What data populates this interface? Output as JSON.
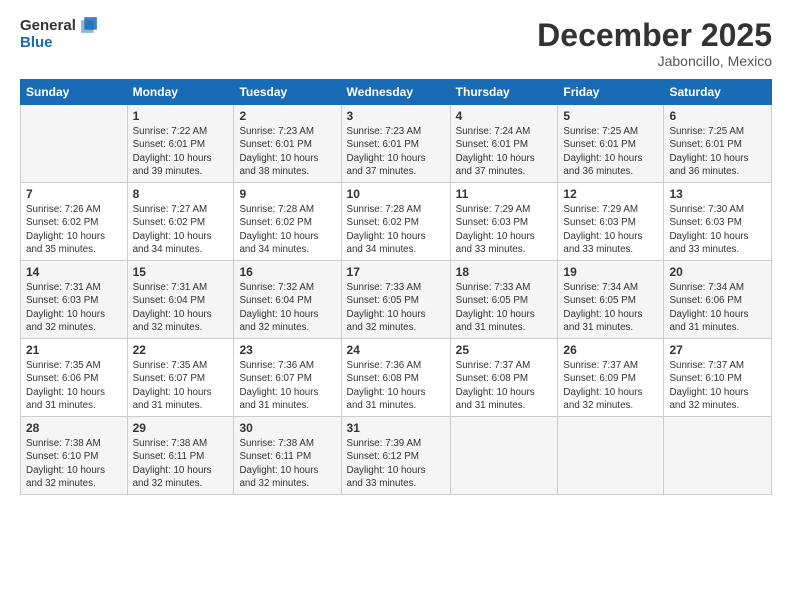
{
  "logo": {
    "general": "General",
    "blue": "Blue"
  },
  "title": "December 2025",
  "location": "Jaboncillo, Mexico",
  "days_header": [
    "Sunday",
    "Monday",
    "Tuesday",
    "Wednesday",
    "Thursday",
    "Friday",
    "Saturday"
  ],
  "weeks": [
    [
      {
        "day": "",
        "info": ""
      },
      {
        "day": "1",
        "info": "Sunrise: 7:22 AM\nSunset: 6:01 PM\nDaylight: 10 hours\nand 39 minutes."
      },
      {
        "day": "2",
        "info": "Sunrise: 7:23 AM\nSunset: 6:01 PM\nDaylight: 10 hours\nand 38 minutes."
      },
      {
        "day": "3",
        "info": "Sunrise: 7:23 AM\nSunset: 6:01 PM\nDaylight: 10 hours\nand 37 minutes."
      },
      {
        "day": "4",
        "info": "Sunrise: 7:24 AM\nSunset: 6:01 PM\nDaylight: 10 hours\nand 37 minutes."
      },
      {
        "day": "5",
        "info": "Sunrise: 7:25 AM\nSunset: 6:01 PM\nDaylight: 10 hours\nand 36 minutes."
      },
      {
        "day": "6",
        "info": "Sunrise: 7:25 AM\nSunset: 6:01 PM\nDaylight: 10 hours\nand 36 minutes."
      }
    ],
    [
      {
        "day": "7",
        "info": "Sunrise: 7:26 AM\nSunset: 6:02 PM\nDaylight: 10 hours\nand 35 minutes."
      },
      {
        "day": "8",
        "info": "Sunrise: 7:27 AM\nSunset: 6:02 PM\nDaylight: 10 hours\nand 34 minutes."
      },
      {
        "day": "9",
        "info": "Sunrise: 7:28 AM\nSunset: 6:02 PM\nDaylight: 10 hours\nand 34 minutes."
      },
      {
        "day": "10",
        "info": "Sunrise: 7:28 AM\nSunset: 6:02 PM\nDaylight: 10 hours\nand 34 minutes."
      },
      {
        "day": "11",
        "info": "Sunrise: 7:29 AM\nSunset: 6:03 PM\nDaylight: 10 hours\nand 33 minutes."
      },
      {
        "day": "12",
        "info": "Sunrise: 7:29 AM\nSunset: 6:03 PM\nDaylight: 10 hours\nand 33 minutes."
      },
      {
        "day": "13",
        "info": "Sunrise: 7:30 AM\nSunset: 6:03 PM\nDaylight: 10 hours\nand 33 minutes."
      }
    ],
    [
      {
        "day": "14",
        "info": "Sunrise: 7:31 AM\nSunset: 6:03 PM\nDaylight: 10 hours\nand 32 minutes."
      },
      {
        "day": "15",
        "info": "Sunrise: 7:31 AM\nSunset: 6:04 PM\nDaylight: 10 hours\nand 32 minutes."
      },
      {
        "day": "16",
        "info": "Sunrise: 7:32 AM\nSunset: 6:04 PM\nDaylight: 10 hours\nand 32 minutes."
      },
      {
        "day": "17",
        "info": "Sunrise: 7:33 AM\nSunset: 6:05 PM\nDaylight: 10 hours\nand 32 minutes."
      },
      {
        "day": "18",
        "info": "Sunrise: 7:33 AM\nSunset: 6:05 PM\nDaylight: 10 hours\nand 31 minutes."
      },
      {
        "day": "19",
        "info": "Sunrise: 7:34 AM\nSunset: 6:05 PM\nDaylight: 10 hours\nand 31 minutes."
      },
      {
        "day": "20",
        "info": "Sunrise: 7:34 AM\nSunset: 6:06 PM\nDaylight: 10 hours\nand 31 minutes."
      }
    ],
    [
      {
        "day": "21",
        "info": "Sunrise: 7:35 AM\nSunset: 6:06 PM\nDaylight: 10 hours\nand 31 minutes."
      },
      {
        "day": "22",
        "info": "Sunrise: 7:35 AM\nSunset: 6:07 PM\nDaylight: 10 hours\nand 31 minutes."
      },
      {
        "day": "23",
        "info": "Sunrise: 7:36 AM\nSunset: 6:07 PM\nDaylight: 10 hours\nand 31 minutes."
      },
      {
        "day": "24",
        "info": "Sunrise: 7:36 AM\nSunset: 6:08 PM\nDaylight: 10 hours\nand 31 minutes."
      },
      {
        "day": "25",
        "info": "Sunrise: 7:37 AM\nSunset: 6:08 PM\nDaylight: 10 hours\nand 31 minutes."
      },
      {
        "day": "26",
        "info": "Sunrise: 7:37 AM\nSunset: 6:09 PM\nDaylight: 10 hours\nand 32 minutes."
      },
      {
        "day": "27",
        "info": "Sunrise: 7:37 AM\nSunset: 6:10 PM\nDaylight: 10 hours\nand 32 minutes."
      }
    ],
    [
      {
        "day": "28",
        "info": "Sunrise: 7:38 AM\nSunset: 6:10 PM\nDaylight: 10 hours\nand 32 minutes."
      },
      {
        "day": "29",
        "info": "Sunrise: 7:38 AM\nSunset: 6:11 PM\nDaylight: 10 hours\nand 32 minutes."
      },
      {
        "day": "30",
        "info": "Sunrise: 7:38 AM\nSunset: 6:11 PM\nDaylight: 10 hours\nand 32 minutes."
      },
      {
        "day": "31",
        "info": "Sunrise: 7:39 AM\nSunset: 6:12 PM\nDaylight: 10 hours\nand 33 minutes."
      },
      {
        "day": "",
        "info": ""
      },
      {
        "day": "",
        "info": ""
      },
      {
        "day": "",
        "info": ""
      }
    ]
  ]
}
